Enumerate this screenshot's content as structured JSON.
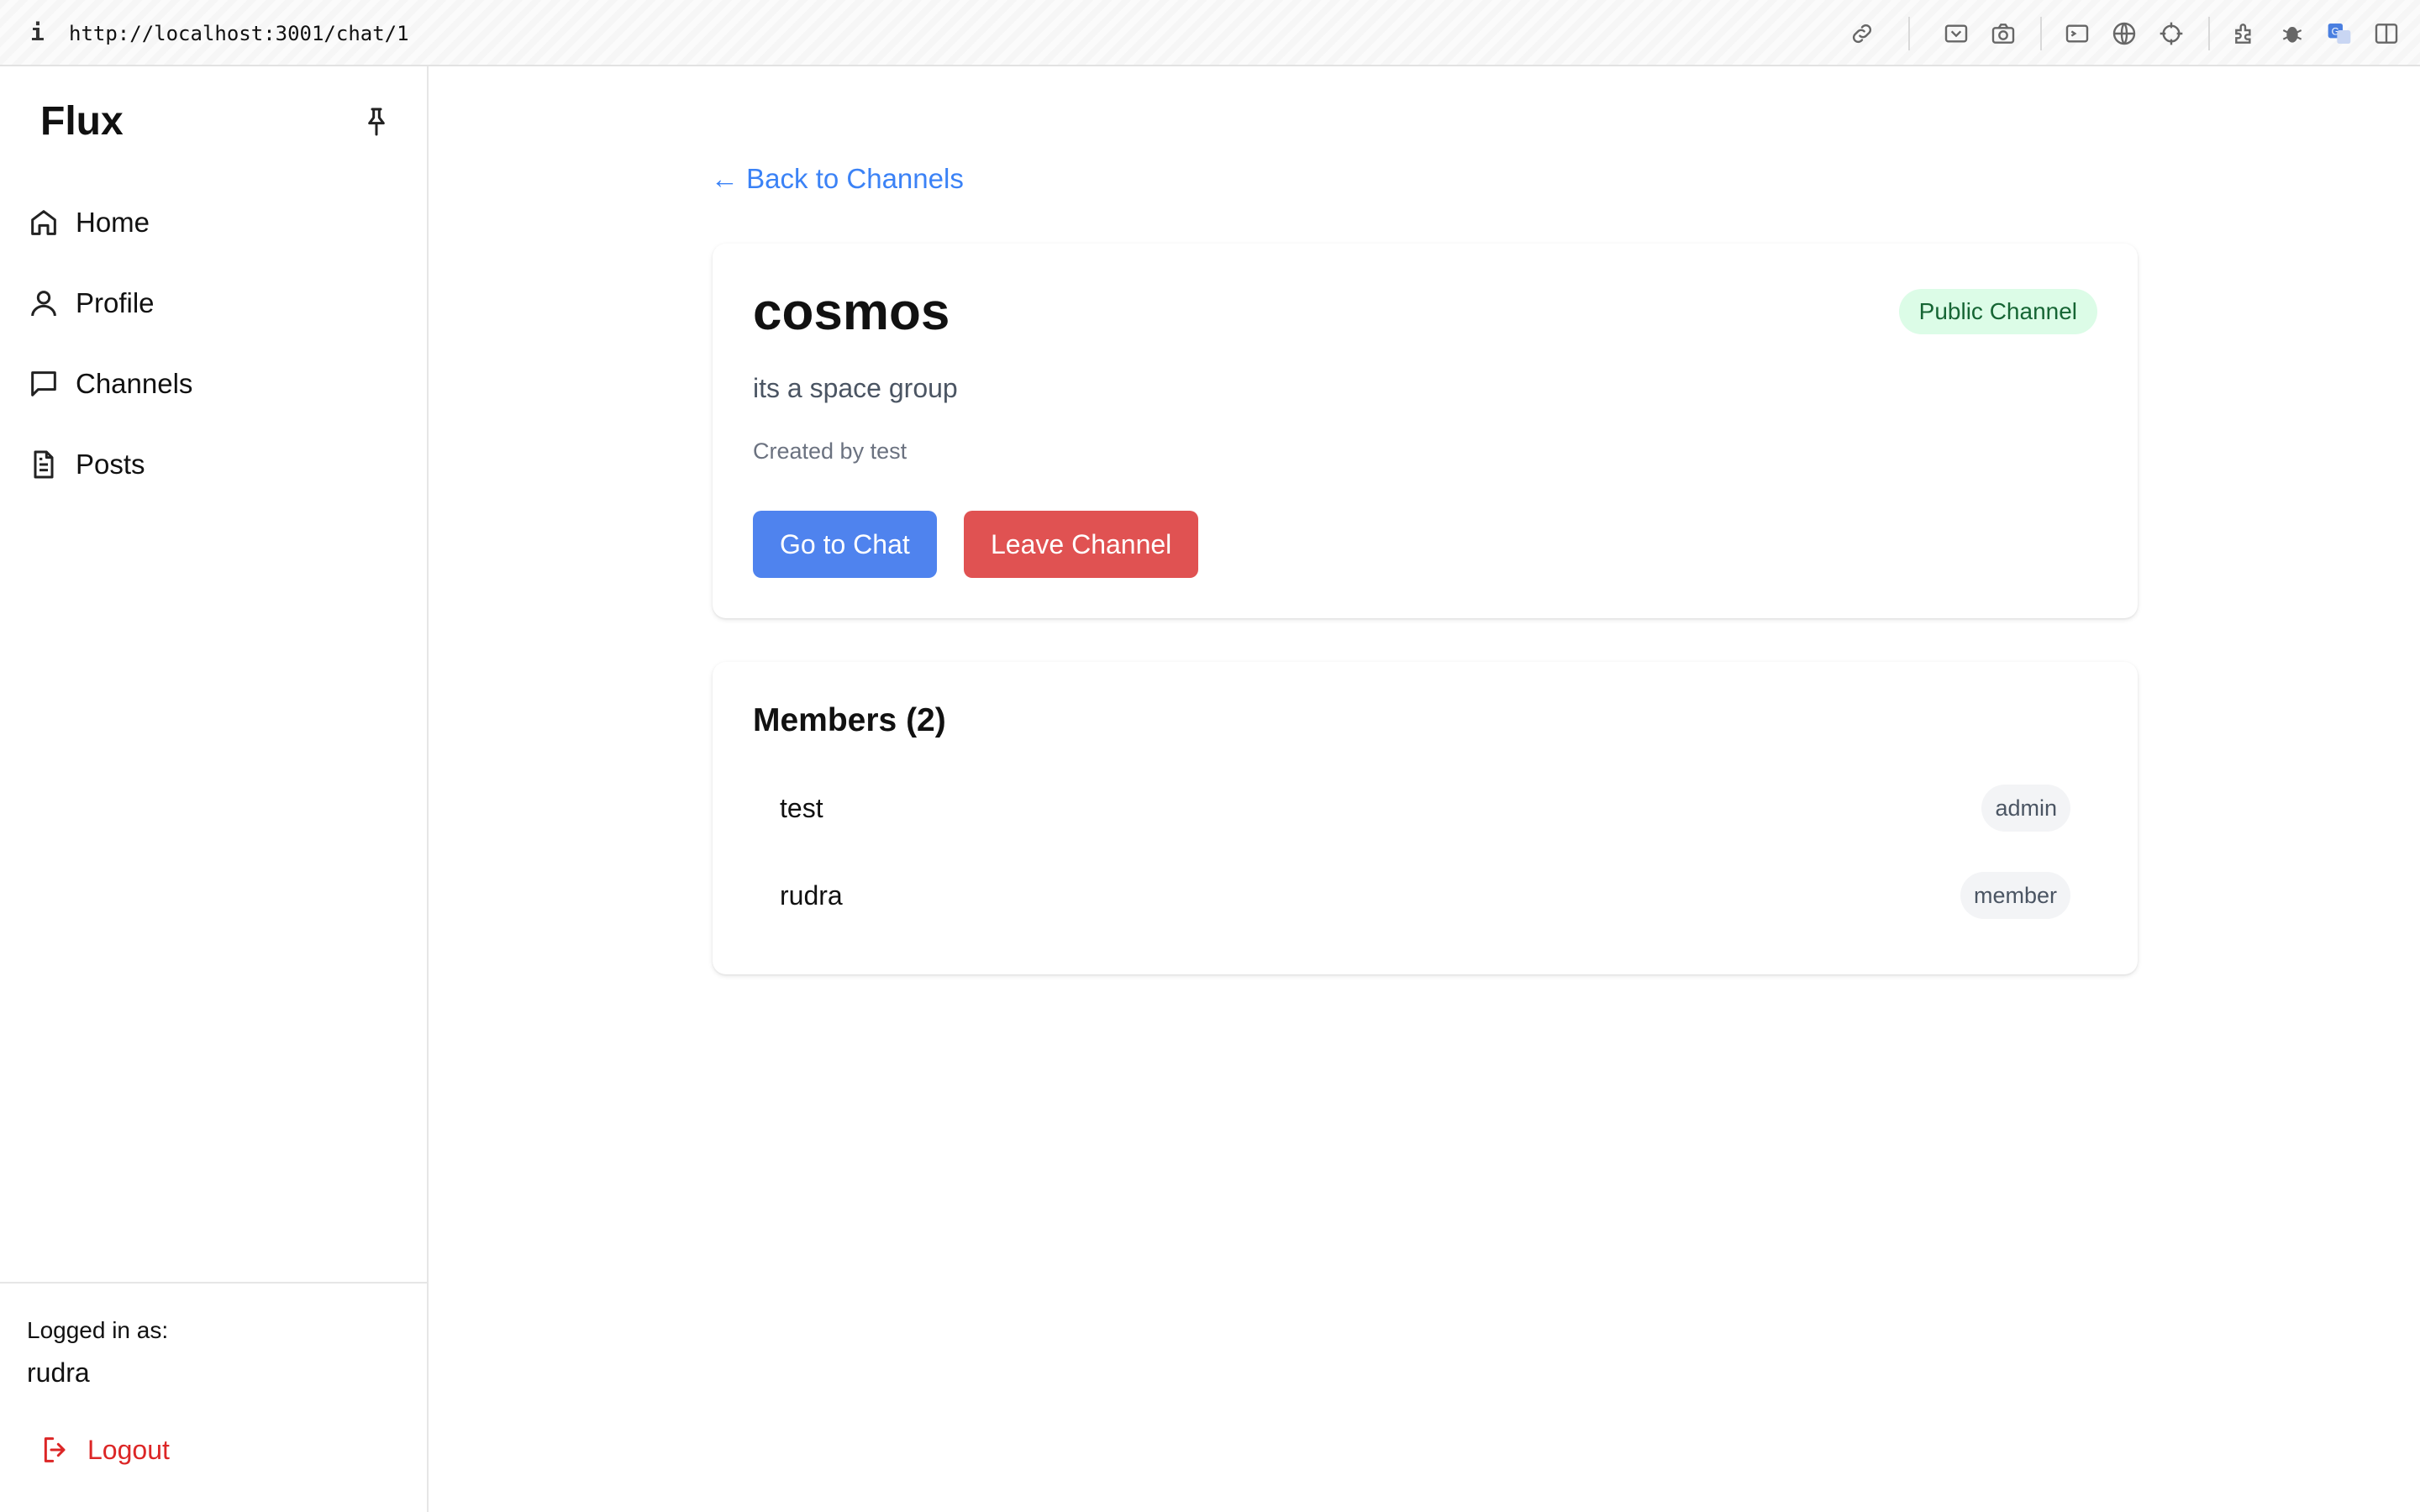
{
  "browser": {
    "info": "i",
    "url": "http://localhost:3001/chat/1",
    "toolbar_icons": [
      "link-icon",
      "screen-capture-icon",
      "camera-icon",
      "terminal-icon",
      "globe-icon",
      "crosshair-icon",
      "extensions-icon",
      "bug-icon",
      "translate-icon",
      "sidebar-toggle-icon"
    ]
  },
  "sidebar": {
    "brand": "Flux",
    "items": [
      {
        "label": "Home",
        "icon": "home-icon"
      },
      {
        "label": "Profile",
        "icon": "user-icon"
      },
      {
        "label": "Channels",
        "icon": "message-icon"
      },
      {
        "label": "Posts",
        "icon": "document-icon"
      }
    ],
    "logged_in_label": "Logged in as:",
    "logged_in_user": "rudra",
    "logout_label": "Logout"
  },
  "main": {
    "back_link": "← Back to Channels",
    "channel": {
      "name": "cosmos",
      "badge": "Public Channel",
      "description": "its a space group",
      "created_by": "Created by test",
      "go_to_chat": "Go to Chat",
      "leave_channel": "Leave Channel"
    },
    "members": {
      "title": "Members (2)",
      "list": [
        {
          "name": "test",
          "role": "admin"
        },
        {
          "name": "rudra",
          "role": "member"
        }
      ]
    }
  },
  "colors": {
    "link": "#3b82f6",
    "primary_button": "#4f83ee",
    "danger_button": "#e05252",
    "public_badge_bg": "#dcfce7",
    "public_badge_text": "#166534",
    "logout": "#dc2626"
  }
}
